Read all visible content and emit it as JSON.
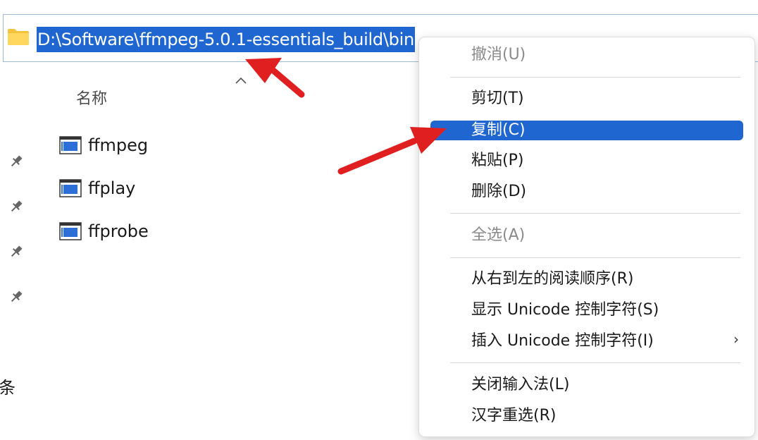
{
  "address_bar": {
    "path": "D:\\Software\\ffmpeg-5.0.1-essentials_build\\bin"
  },
  "file_list": {
    "column_header": "名称",
    "items": [
      {
        "name": "ffmpeg"
      },
      {
        "name": "ffplay"
      },
      {
        "name": "ffprobe"
      }
    ]
  },
  "sidebar": {
    "partial_text": "条"
  },
  "context_menu": {
    "items": [
      {
        "label": "撤消(U)",
        "enabled": false
      },
      {
        "label": "剪切(T)",
        "enabled": true
      },
      {
        "label": "复制(C)",
        "enabled": true,
        "highlighted": true
      },
      {
        "label": "粘贴(P)",
        "enabled": true
      },
      {
        "label": "删除(D)",
        "enabled": true
      },
      {
        "label": "全选(A)",
        "enabled": false
      },
      {
        "label": "从右到左的阅读顺序(R)",
        "enabled": true
      },
      {
        "label": "显示 Unicode 控制字符(S)",
        "enabled": true
      },
      {
        "label": "插入 Unicode 控制字符(I)",
        "enabled": true,
        "submenu": true
      },
      {
        "label": "关闭输入法(L)",
        "enabled": true
      },
      {
        "label": "汉字重选(R)",
        "enabled": true
      }
    ],
    "submenu_chevron": "›"
  },
  "colors": {
    "selection": "#1f66d1",
    "annotation_arrow": "#e02020",
    "folder": "#f4c23c"
  }
}
